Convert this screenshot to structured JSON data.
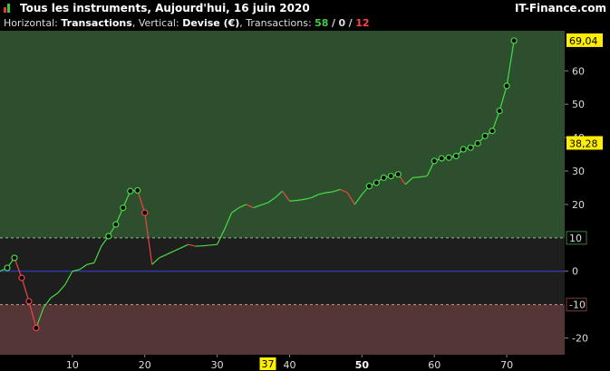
{
  "window": {
    "title": "Tous les instruments, Aujourd'hui, 16 juin 2020",
    "brand": "IT-Finance.com"
  },
  "info": {
    "horizontal_label": "Horizontal:",
    "horizontal_value": "Transactions",
    "sep1": ",",
    "vertical_label": "Vertical:",
    "vertical_value": "Devise (€)",
    "sep2": ",",
    "transactions_label": "Transactions:",
    "win": "58",
    "slash": "/",
    "neutral": "0",
    "loss": "12"
  },
  "colors": {
    "profit_zone": "#2e4f2e",
    "neutral_zone": "#1e1e1e",
    "loss_zone": "#553636",
    "up_line": "#44dd44",
    "down_line": "#ee4444",
    "zero_line": "#3344dd",
    "highlight": "#ffee00"
  },
  "chart_data": {
    "type": "line",
    "xlabel": "Transactions",
    "ylabel": "Devise (€)",
    "xlim": [
      0,
      78
    ],
    "ylim": [
      -25,
      72
    ],
    "x_ticks": [
      10,
      20,
      30,
      40,
      50,
      60,
      70
    ],
    "x_highlight_label": "37",
    "x_bold_tick": 50,
    "y_ticks": [
      -20,
      0,
      20,
      30,
      40,
      50,
      60
    ],
    "y_highlight_labels": [
      "69,04",
      "38,28"
    ],
    "y_threshold_labels": [
      "10",
      "-10"
    ],
    "profit_threshold": 10,
    "loss_threshold": -10,
    "last_value_label": "69,04",
    "max_value_label": "38,28",
    "series": [
      {
        "values": [
          0,
          1.0,
          4.0,
          -2.0,
          -9.0,
          -17.0,
          -11.0,
          -8.0,
          -6.5,
          -4.0,
          0.0,
          0.5,
          2.0,
          2.5,
          7.5,
          10.5,
          14.0,
          19.0,
          24.0,
          24.2,
          17.5,
          2.0,
          4.0,
          5.0,
          6.0,
          7.0,
          8.0,
          7.5,
          7.6,
          7.8,
          8.0,
          12.5,
          17.5,
          19.0,
          20.0,
          19.0,
          19.8,
          20.5,
          22.0,
          24.0,
          21.0,
          21.2,
          21.5,
          22.0,
          23.0,
          23.5,
          23.8,
          24.5,
          23.5,
          20.0,
          23.0,
          25.5,
          26.5,
          28.0,
          28.5,
          29.0,
          26.0,
          28.0,
          28.2,
          28.5,
          33.0,
          33.8,
          34.0,
          34.5,
          36.5,
          37.0,
          38.3,
          40.5,
          42.0,
          48.0,
          55.5,
          69.04
        ]
      }
    ]
  }
}
